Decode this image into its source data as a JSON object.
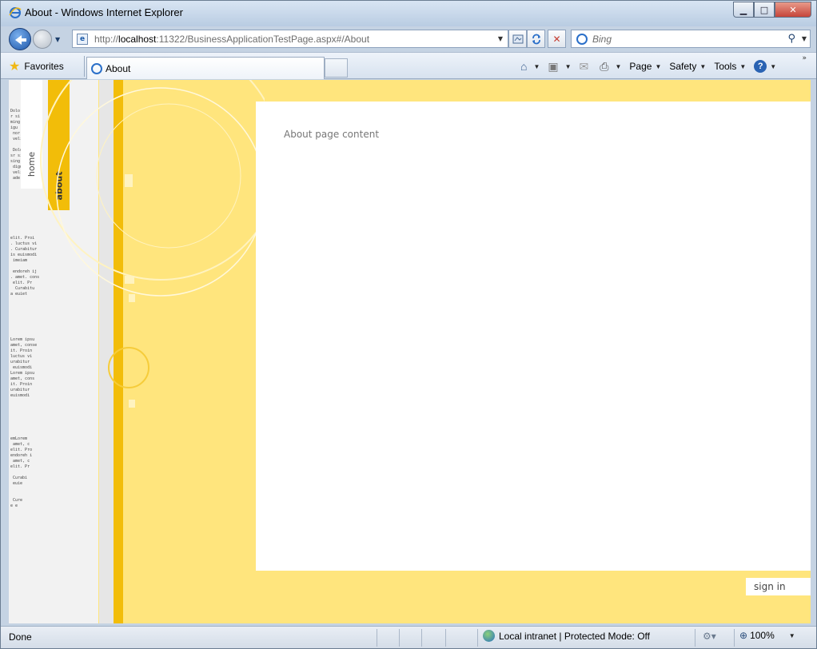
{
  "window": {
    "title": "About - Windows Internet Explorer",
    "minimize_glyph": "▁",
    "maximize_glyph": "□",
    "close_glyph": "✕"
  },
  "navigation": {
    "url_scheme": "http://",
    "url_host": "localhost",
    "url_rest": ":11322/BusinessApplicationTestPage.aspx#/About",
    "search_placeholder": "Bing"
  },
  "commandbar": {
    "favorites_label": "Favorites",
    "tab_title": "About",
    "page_label": "Page",
    "safety_label": "Safety",
    "tools_label": "Tools",
    "help_glyph": "?"
  },
  "app": {
    "nav_tabs": [
      {
        "label": "home"
      },
      {
        "label": "about"
      }
    ],
    "page_content": "About page content",
    "signin_label": "sign in",
    "colors": {
      "accent": "#f2bd09",
      "background": "#ffe57d"
    }
  },
  "statusbar": {
    "status": "Done",
    "zone": "Local intranet | Protected Mode: Off",
    "zoom": "100%"
  }
}
